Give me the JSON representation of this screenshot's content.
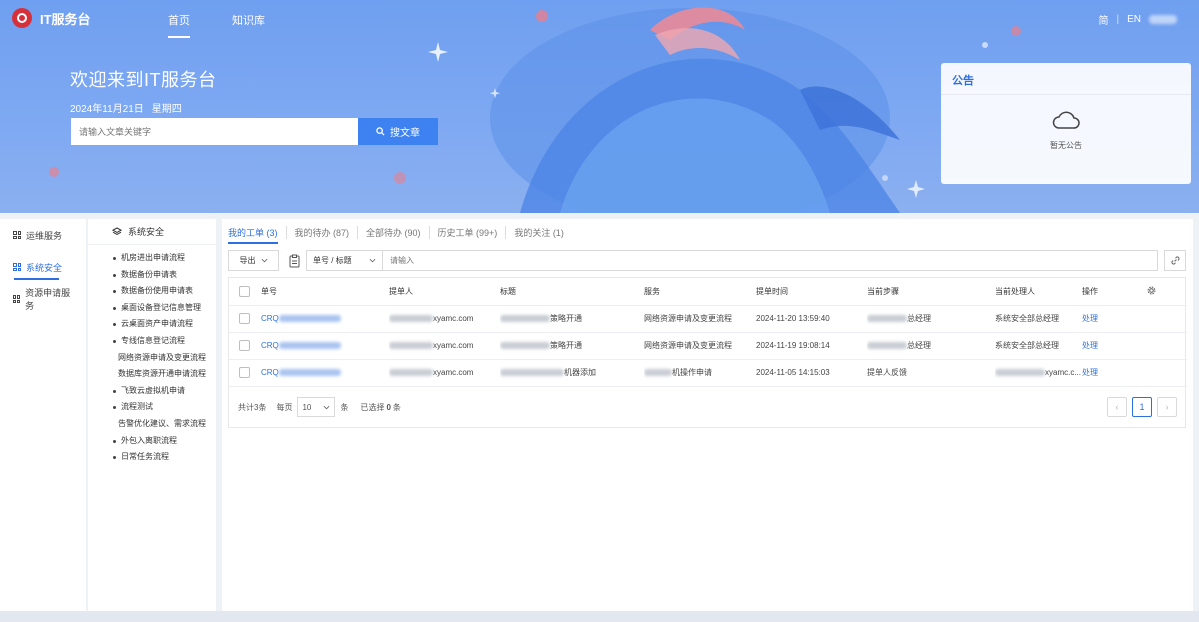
{
  "header": {
    "app_title": "IT服务台",
    "nav": [
      {
        "label": "首页",
        "active": true
      },
      {
        "label": "知识库",
        "active": false
      }
    ],
    "lang_zh": "简",
    "lang_en": "EN"
  },
  "banner": {
    "welcome": "欢迎来到IT服务台",
    "date": "2024年11月21日",
    "weekday": "星期四",
    "search_placeholder": "请输入文章关键字",
    "search_button": "搜文章"
  },
  "notice": {
    "title": "公告",
    "empty_text": "暂无公告"
  },
  "leftnav": {
    "items": [
      {
        "label": "运维服务",
        "active": false
      },
      {
        "label": "系统安全",
        "active": true
      },
      {
        "label": "资源申请服务",
        "active": false
      }
    ]
  },
  "submenu": {
    "title": "系统安全",
    "items": [
      {
        "label": "机房进出申请流程",
        "bullet": true
      },
      {
        "label": "数据备份申请表",
        "bullet": true
      },
      {
        "label": "数据备份使用申请表",
        "bullet": true
      },
      {
        "label": "桌面设备登记信息管理",
        "bullet": true
      },
      {
        "label": "云桌面资产申请流程",
        "bullet": true
      },
      {
        "label": "专线信息登记流程",
        "bullet": true
      },
      {
        "label": "网络资源申请及变更流程",
        "bullet": false
      },
      {
        "label": "数据库资源开通申请流程",
        "bullet": false
      },
      {
        "label": "飞致云虚拟机申请",
        "bullet": true
      },
      {
        "label": "流程测试",
        "bullet": true
      },
      {
        "label": "告警优化建议、需求流程",
        "bullet": false
      },
      {
        "label": "外包入离职流程",
        "bullet": true
      },
      {
        "label": "日常任务流程",
        "bullet": true
      }
    ]
  },
  "tabs": [
    {
      "label": "我的工单 (3)",
      "active": true
    },
    {
      "label": "我的待办 (87)",
      "active": false
    },
    {
      "label": "全部待办 (90)",
      "active": false
    },
    {
      "label": "历史工单 (99+)",
      "active": false
    },
    {
      "label": "我的关注 (1)",
      "active": false
    }
  ],
  "toolbar": {
    "export_label": "导出",
    "field_select": "单号 / 标题",
    "filter_placeholder": "请输入"
  },
  "table": {
    "columns": [
      "单号",
      "提单人",
      "标题",
      "服务",
      "提单时间",
      "当前步骤",
      "当前处理人",
      "操作"
    ],
    "rows": [
      {
        "id_prefix": "CRQ",
        "submitter_suffix": "xyamc.com",
        "title_suffix": "策略开通",
        "service": "网络资源申请及变更流程",
        "time": "2024-11-20 13:59:40",
        "step_suffix": "总经理",
        "handler": "系统安全部总经理",
        "action": "处理"
      },
      {
        "id_prefix": "CRQ",
        "submitter_suffix": "xyamc.com",
        "title_suffix": "策略开通",
        "service": "网络资源申请及变更流程",
        "time": "2024-11-19 19:08:14",
        "step_suffix": "总经理",
        "handler": "系统安全部总经理",
        "action": "处理"
      },
      {
        "id_prefix": "CRQ",
        "submitter_suffix": "xyamc.com",
        "title_suffix": "机器添加",
        "service": "机操作申请",
        "time": "2024-11-05 14:15:03",
        "step": "提单人反馈",
        "handler_suffix": "xyamc.c...",
        "action": "处理"
      }
    ]
  },
  "footer": {
    "total_prefix": "共计",
    "total_count": "3",
    "total_suffix": "条",
    "per_page_label": "每页",
    "page_size": "10",
    "page_size_unit": "条",
    "selected_prefix": "已选择",
    "selected_count": "0",
    "selected_suffix": "条",
    "current_page": "1"
  },
  "colors": {
    "accent": "#2d6fe0",
    "banner": "#7fa9f2",
    "brand_red": "#d6303b"
  }
}
